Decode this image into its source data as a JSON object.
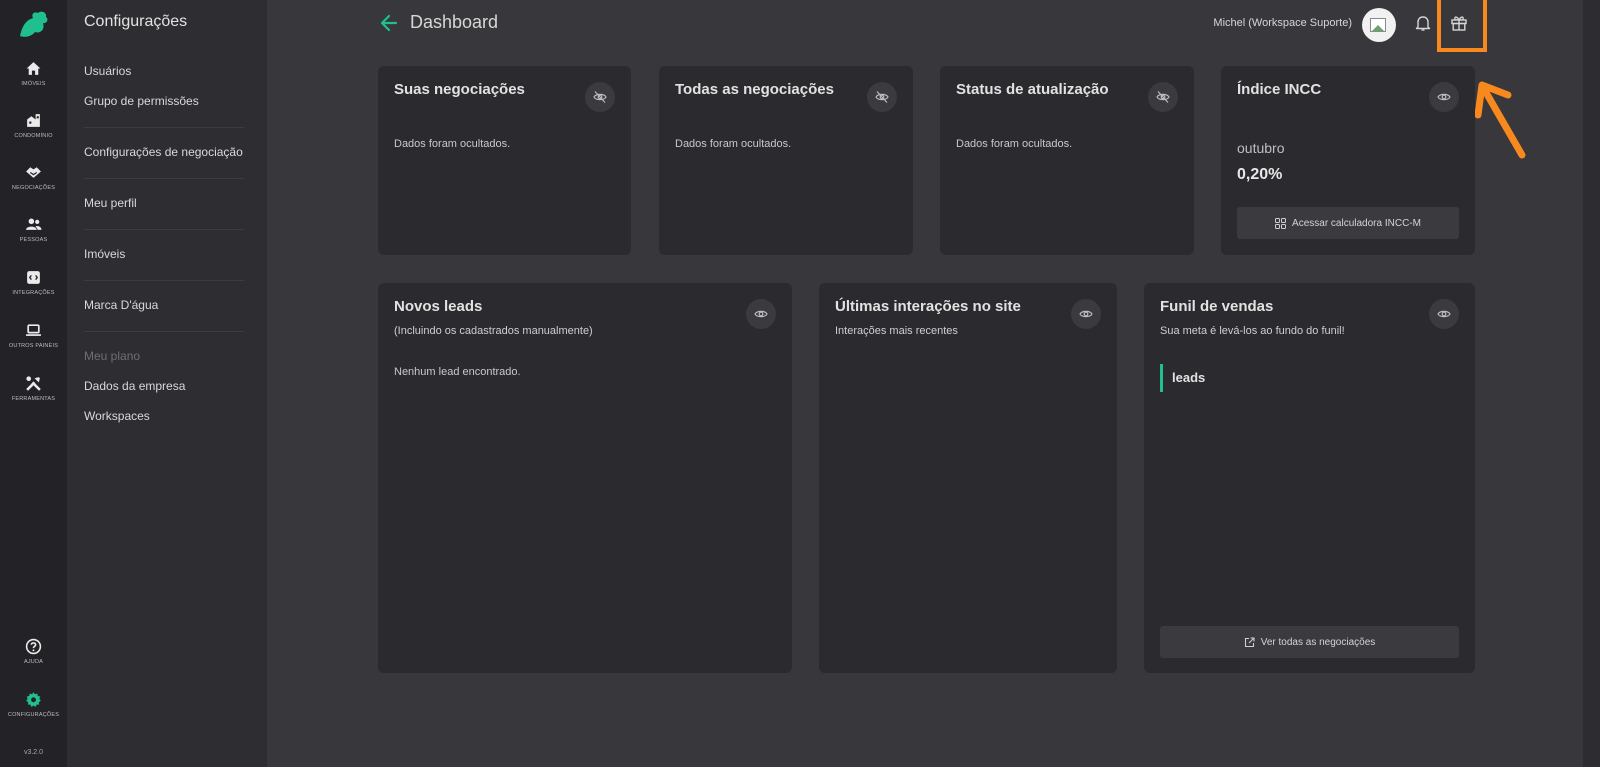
{
  "rail": {
    "items": [
      {
        "label": "IMÓVEIS",
        "icon": "home-icon"
      },
      {
        "label": "CONDOMÍNIO",
        "icon": "building-icon"
      },
      {
        "label": "NEGOCIAÇÕES",
        "icon": "handshake-icon"
      },
      {
        "label": "PESSOAS",
        "icon": "people-icon"
      },
      {
        "label": "INTEGRAÇÕES",
        "icon": "integrations-icon"
      },
      {
        "label": "OUTROS PAINÉIS",
        "icon": "laptop-icon"
      },
      {
        "label": "FERRAMENTAS",
        "icon": "tools-icon"
      }
    ],
    "help": {
      "label": "AJUDA",
      "icon": "help-icon"
    },
    "settings": {
      "label": "CONFIGURAÇÕES",
      "icon": "gear-icon"
    },
    "version": "v3.2.0",
    "accent": "#1fbf8f"
  },
  "settings_menu": {
    "title": "Configurações",
    "items": [
      {
        "label": "Usuários"
      },
      {
        "label": "Grupo de permissões"
      },
      {
        "label": "Configurações de negociação"
      },
      {
        "label": "Meu perfil"
      },
      {
        "label": "Imóveis"
      },
      {
        "label": "Marca D'água"
      },
      {
        "label": "Meu plano",
        "disabled": true
      },
      {
        "label": "Dados da empresa"
      },
      {
        "label": "Workspaces"
      }
    ]
  },
  "header": {
    "title": "Dashboard",
    "user": "Michel (Workspace Suporte)",
    "highlight_color": "#f7891f"
  },
  "cards": {
    "suas": {
      "title": "Suas negociações",
      "text": "Dados foram ocultados."
    },
    "todas": {
      "title": "Todas as negociações",
      "text": "Dados foram ocultados."
    },
    "status": {
      "title": "Status de atualização",
      "text": "Dados foram ocultados."
    },
    "incc": {
      "title": "Índice INCC",
      "month": "outubro",
      "value": "0,20%",
      "button": "Acessar calculadora INCC-M"
    },
    "leads": {
      "title": "Novos leads",
      "subtitle": "(Incluindo os cadastrados manualmente)",
      "text": "Nenhum lead encontrado."
    },
    "interacoes": {
      "title": "Últimas interações no site",
      "subtitle": "Interações mais recentes"
    },
    "funil": {
      "title": "Funil de vendas",
      "subtitle": "Sua meta é levá-los ao fundo do funil!",
      "stage": "leads",
      "button": "Ver todas as negociações"
    }
  }
}
